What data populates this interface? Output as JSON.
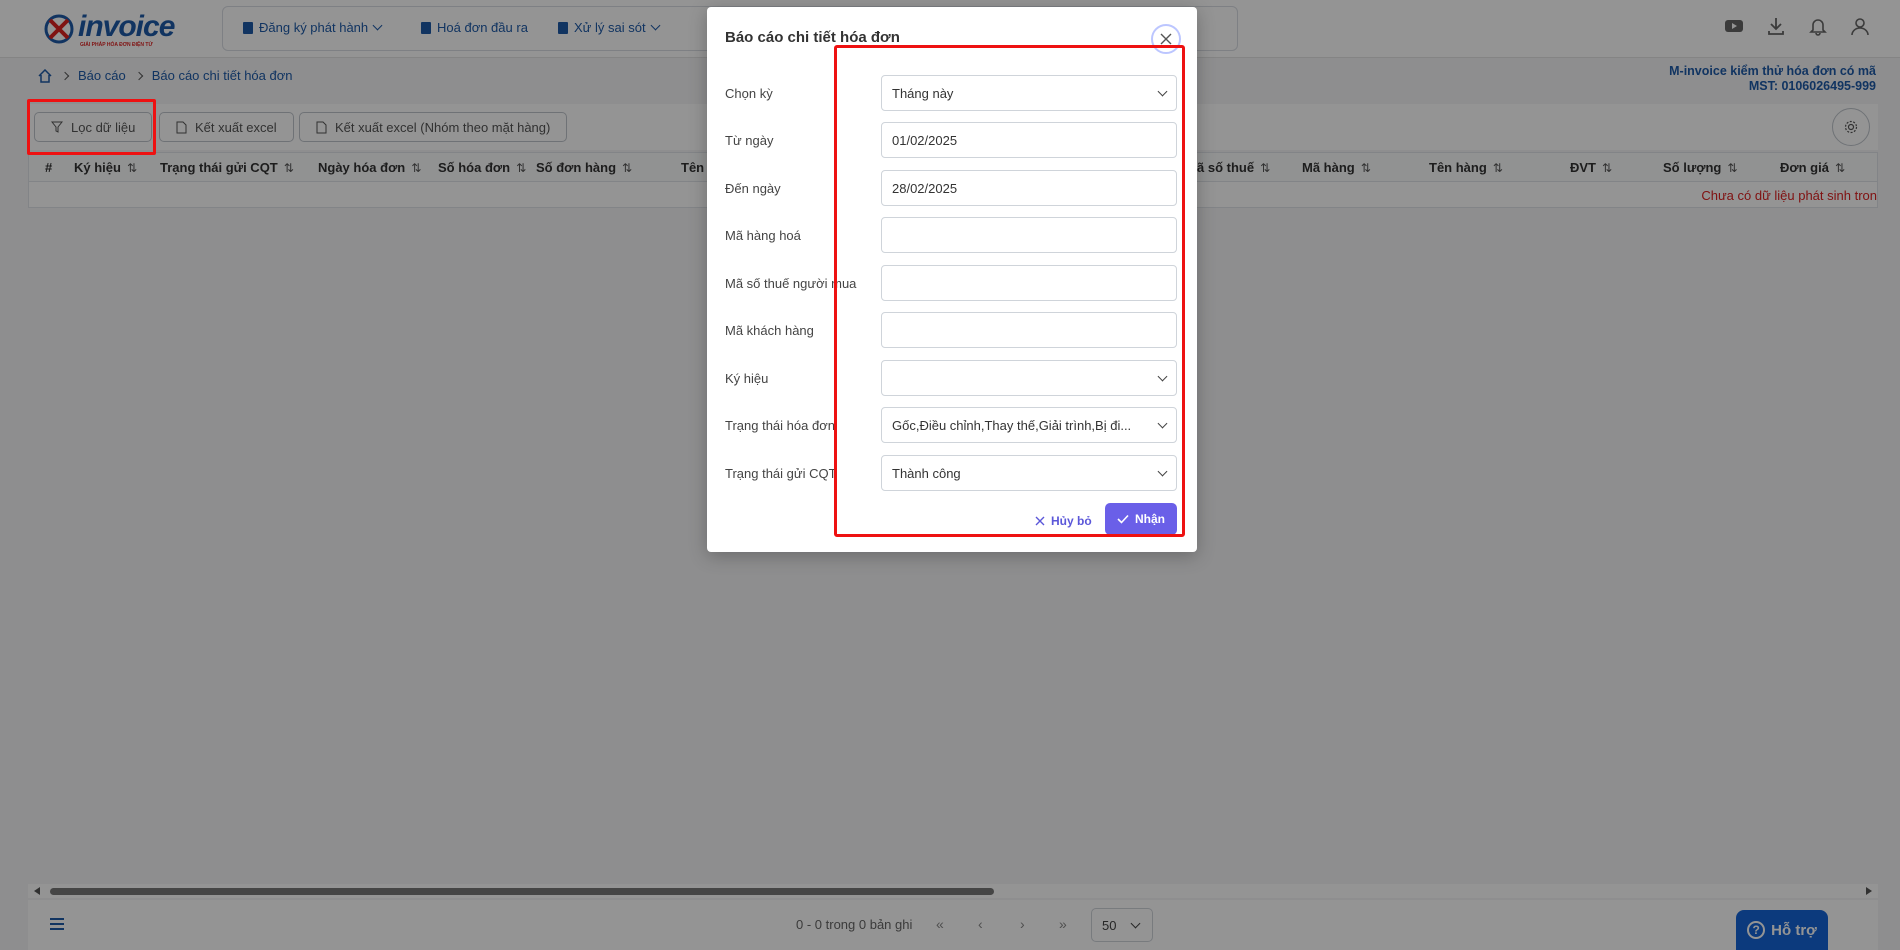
{
  "logo": {
    "name": "invoice",
    "tagline": "GIẢI PHÁP HÓA ĐƠN ĐIỆN TỬ"
  },
  "nav": {
    "items": [
      {
        "label": "Đăng ký phát hành",
        "icon": "document-icon"
      },
      {
        "label": "Hoá đơn đầu ra",
        "icon": "document-icon"
      },
      {
        "label": "Xử lý sai sót",
        "icon": "document-icon"
      }
    ]
  },
  "breadcrumb": {
    "items": [
      "Báo cáo",
      "Báo cáo chi tiết hóa đơn"
    ]
  },
  "company": {
    "name": "M-invoice kiểm thử hóa đơn có mã",
    "tax_id": "MST: 0106026495-999"
  },
  "toolbar": {
    "filter_label": "Lọc dữ liệu",
    "export_label": "Kết xuất excel",
    "export_group_label": "Kết xuất excel (Nhóm theo mặt hàng)"
  },
  "table": {
    "columns": [
      "#",
      "Ký hiệu",
      "Trạng thái gửi CQT",
      "Ngày hóa đơn",
      "Số hóa đơn",
      "Số đơn hàng",
      "Tên c",
      "ã số thuế",
      "Mã hàng",
      "Tên hàng",
      "ĐVT",
      "Số lượng",
      "Đơn giá"
    ],
    "sort_glyph": "⇅",
    "empty_message": "Chưa có dữ liệu phát sinh tron"
  },
  "pager": {
    "summary": "0 - 0 trong 0 bản ghi",
    "first": "«",
    "prev": "‹",
    "next": "›",
    "last": "»",
    "page_size": "50"
  },
  "support": {
    "label": "Hỗ trợ"
  },
  "modal": {
    "title": "Báo cáo chi tiết hóa đơn",
    "fields": [
      {
        "label": "Chọn kỳ",
        "value": "Tháng này",
        "type": "select"
      },
      {
        "label": "Từ ngày",
        "value": "01/02/2025",
        "type": "input"
      },
      {
        "label": "Đến ngày",
        "value": "28/02/2025",
        "type": "input"
      },
      {
        "label": "Mã hàng hoá",
        "value": "",
        "type": "input"
      },
      {
        "label": "Mã số thuế người mua",
        "value": "",
        "type": "input"
      },
      {
        "label": "Mã khách hàng",
        "value": "",
        "type": "input"
      },
      {
        "label": "Ký hiệu",
        "value": "",
        "type": "select"
      },
      {
        "label": "Trạng thái hóa đơn",
        "value": "Gốc,Điều chỉnh,Thay thế,Giải trình,Bị đi...",
        "type": "select"
      },
      {
        "label": "Trạng thái gửi CQT",
        "value": "Thành công",
        "type": "select"
      }
    ],
    "cancel_label": "Hủy bỏ",
    "ok_label": "Nhận"
  },
  "colors": {
    "brand": "#1e5aa8",
    "accent": "#6a5fe8",
    "annotation": "#e11",
    "error": "#d22"
  }
}
